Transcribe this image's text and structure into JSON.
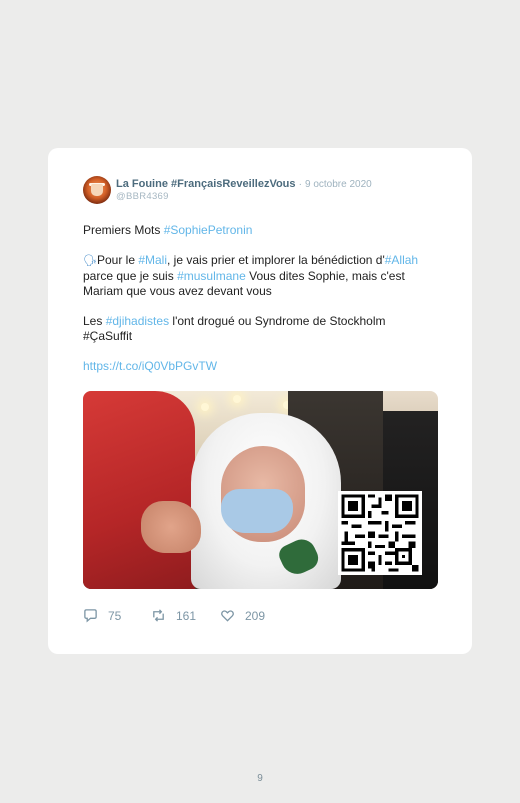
{
  "tweet": {
    "author_name": "La Fouine #FrançaisReveillezVous",
    "separator": "·",
    "date": "9 octobre 2020",
    "handle": "@BBR4369",
    "line1_text": "Premiers Mots ",
    "line1_tag": "#SophiePetronin",
    "pin_icon": "🗣",
    "p2_a": "Pour le ",
    "p2_tag_mali": "#Mali",
    "p2_b": ", je vais prier et implorer la bénédiction d'",
    "p2_tag_allah": "#Allah",
    "p2_c": " parce que je suis ",
    "p2_tag_musulmane": "#musulmane",
    "p2_d": " Vous dites Sophie, mais c'est Mariam que vous avez devant vous",
    "p3_a": "Les ",
    "p3_tag": "#djihadistes",
    "p3_b": " l'ont drogué ou Syndrome de Stockholm",
    "p3_line2": "#ÇaSuffit",
    "link": "https://t.co/iQ0VbPGvTW",
    "replies": "75",
    "retweets": "161",
    "likes": "209"
  },
  "page_number": "9",
  "colors": {
    "page_bg": "#ececeb",
    "card_bg": "#ffffff",
    "author": "#4c6b7d",
    "hashtag": "#62b6e8",
    "meta": "#9fb3bf"
  }
}
